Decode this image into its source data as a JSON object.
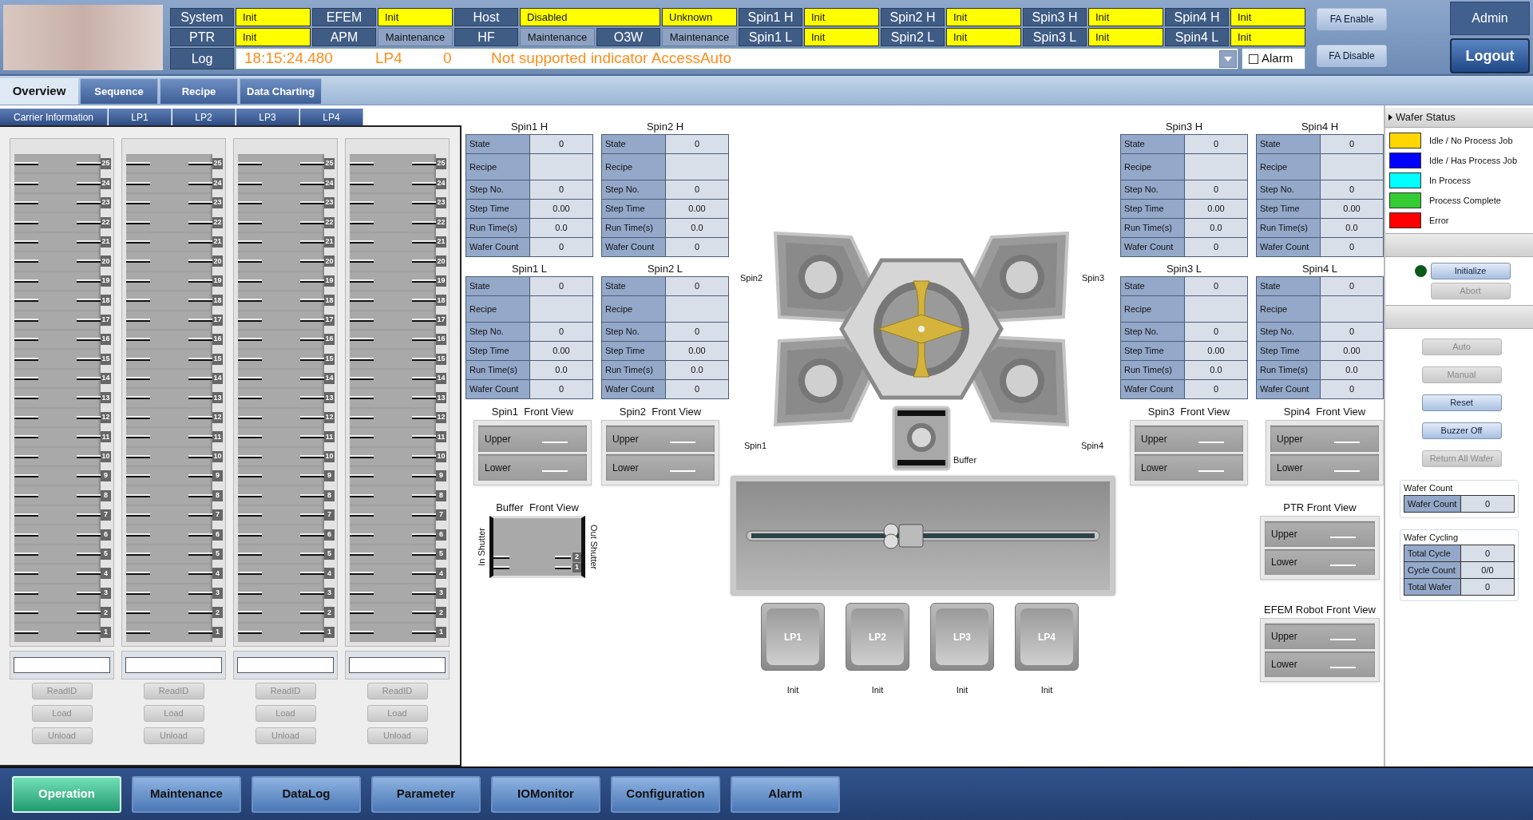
{
  "status_rows": [
    [
      {
        "kind": "label",
        "text": "System"
      },
      {
        "kind": "value",
        "text": "Init",
        "highlighted": true
      },
      {
        "kind": "label",
        "text": "EFEM"
      },
      {
        "kind": "value",
        "text": "Init",
        "highlighted": true
      },
      {
        "kind": "label",
        "text": "Host"
      },
      {
        "kind": "value",
        "text": "Disabled",
        "highlighted": true
      },
      {
        "kind": "value",
        "text": "Unknown",
        "highlighted": true
      },
      {
        "kind": "label",
        "text": "Spin1 H"
      },
      {
        "kind": "value",
        "text": "Init",
        "highlighted": true
      },
      {
        "kind": "label",
        "text": "Spin2 H"
      },
      {
        "kind": "value",
        "text": "Init",
        "highlighted": true
      },
      {
        "kind": "label",
        "text": "Spin3 H"
      },
      {
        "kind": "value",
        "text": "Init",
        "highlighted": true
      },
      {
        "kind": "label",
        "text": "Spin4 H"
      },
      {
        "kind": "value",
        "text": "Init",
        "highlighted": true
      }
    ],
    [
      {
        "kind": "label",
        "text": "PTR"
      },
      {
        "kind": "value",
        "text": "Init",
        "highlighted": true
      },
      {
        "kind": "label",
        "text": "APM"
      },
      {
        "kind": "value",
        "text": "Maintenance",
        "highlighted": false
      },
      {
        "kind": "label",
        "text": "HF"
      },
      {
        "kind": "value",
        "text": "Maintenance",
        "highlighted": false
      },
      {
        "kind": "label",
        "text": "O3W"
      },
      {
        "kind": "value",
        "text": "Maintenance",
        "highlighted": false
      },
      {
        "kind": "label",
        "text": "Spin1 L"
      },
      {
        "kind": "value",
        "text": "Init",
        "highlighted": true
      },
      {
        "kind": "label",
        "text": "Spin2 L"
      },
      {
        "kind": "value",
        "text": "Init",
        "highlighted": true
      },
      {
        "kind": "label",
        "text": "Spin3 L"
      },
      {
        "kind": "value",
        "text": "Init",
        "highlighted": true
      },
      {
        "kind": "label",
        "text": "Spin4 L"
      },
      {
        "kind": "value",
        "text": "Init",
        "highlighted": true
      }
    ]
  ],
  "log": {
    "label": "Log",
    "time": "18:15:24.480",
    "source": "LP4",
    "code": "0",
    "message": "Not supported indicator AccessAuto"
  },
  "alarm": {
    "label": "Alarm",
    "checked": false
  },
  "fa_buttons": [
    "FA Enable",
    "FA Disable"
  ],
  "user": "Admin",
  "logout": "Logout",
  "main_tabs": [
    {
      "label": "Overview",
      "selected": true
    },
    {
      "label": "Sequence",
      "selected": false
    },
    {
      "label": "Recipe",
      "selected": false
    },
    {
      "label": "Data Charting",
      "selected": false
    }
  ],
  "sub_tabs": [
    "Carrier Information",
    "LP1",
    "LP2",
    "LP3",
    "LP4"
  ],
  "carriers": [
    {
      "slots": [
        "25",
        "24",
        "23",
        "22",
        "21",
        "20",
        "19",
        "18",
        "17",
        "16",
        "15",
        "14",
        "13",
        "12",
        "11",
        "10",
        "9",
        "8",
        "7",
        "6",
        "5",
        "4",
        "3",
        "2",
        "1"
      ],
      "buttons": [
        {
          "label": "ReadID",
          "disabled": true
        },
        {
          "label": "Load",
          "disabled": true
        },
        {
          "label": "Unload",
          "disabled": true
        }
      ]
    },
    {
      "slots": [
        "25",
        "24",
        "23",
        "22",
        "21",
        "20",
        "19",
        "18",
        "17",
        "16",
        "15",
        "14",
        "13",
        "12",
        "11",
        "10",
        "9",
        "8",
        "7",
        "6",
        "5",
        "4",
        "3",
        "2",
        "1"
      ],
      "buttons": [
        {
          "label": "ReadID",
          "disabled": true
        },
        {
          "label": "Load",
          "disabled": true
        },
        {
          "label": "Unload",
          "disabled": true
        }
      ]
    },
    {
      "slots": [
        "25",
        "24",
        "23",
        "22",
        "21",
        "20",
        "19",
        "18",
        "17",
        "16",
        "15",
        "14",
        "13",
        "12",
        "11",
        "10",
        "9",
        "8",
        "7",
        "6",
        "5",
        "4",
        "3",
        "2",
        "1"
      ],
      "buttons": [
        {
          "label": "ReadID",
          "disabled": true
        },
        {
          "label": "Load",
          "disabled": true
        },
        {
          "label": "Unload",
          "disabled": true
        }
      ]
    },
    {
      "slots": [
        "25",
        "24",
        "23",
        "22",
        "21",
        "20",
        "19",
        "18",
        "17",
        "16",
        "15",
        "14",
        "13",
        "12",
        "11",
        "10",
        "9",
        "8",
        "7",
        "6",
        "5",
        "4",
        "3",
        "2",
        "1"
      ],
      "buttons": [
        {
          "label": "ReadID",
          "disabled": true
        },
        {
          "label": "Load",
          "disabled": true
        },
        {
          "label": "Unload",
          "disabled": true
        }
      ]
    }
  ],
  "left_tables": [
    {
      "title": "Spin1 H",
      "rows": [
        {
          "label": "State",
          "value": "0"
        },
        {
          "label": "Recipe"
        },
        {
          "label": "Step No.",
          "value": "0"
        },
        {
          "label": "Step Time",
          "value": "0.00"
        },
        {
          "label": "Run Time(s)",
          "value": "0.0"
        },
        {
          "label": "Wafer Count",
          "value": "0"
        }
      ]
    },
    {
      "title": "Spin2 H",
      "rows": [
        {
          "label": "State",
          "value": "0"
        },
        {
          "label": "Recipe"
        },
        {
          "label": "Step No.",
          "value": "0"
        },
        {
          "label": "Step Time",
          "value": "0.00"
        },
        {
          "label": "Run Time(s)",
          "value": "0.0"
        },
        {
          "label": "Wafer Count",
          "value": "0"
        }
      ]
    },
    {
      "title": "Spin1 L",
      "rows": [
        {
          "label": "State",
          "value": "0"
        },
        {
          "label": "Recipe"
        },
        {
          "label": "Step No.",
          "value": "0"
        },
        {
          "label": "Step Time",
          "value": "0.00"
        },
        {
          "label": "Run Time(s)",
          "value": "0.0"
        },
        {
          "label": "Wafer Count",
          "value": "0"
        }
      ]
    },
    {
      "title": "Spin2 L",
      "rows": [
        {
          "label": "State",
          "value": "0"
        },
        {
          "label": "Recipe"
        },
        {
          "label": "Step No.",
          "value": "0"
        },
        {
          "label": "Step Time",
          "value": "0.00"
        },
        {
          "label": "Run Time(s)",
          "value": "0.0"
        },
        {
          "label": "Wafer Count",
          "value": "0"
        }
      ]
    }
  ],
  "left_front_views": [
    {
      "title": "Spin1  Front View",
      "slots": [
        "Upper",
        "Lower"
      ]
    },
    {
      "title": "Spin2  Front View",
      "slots": [
        "Upper",
        "Lower"
      ]
    }
  ],
  "buffer_view": {
    "title": "Buffer  Front View",
    "left_label": "In Shutter",
    "right_label": "Out Shutter",
    "slots": [
      "2",
      "1"
    ]
  },
  "tool": {
    "chamber_labels": [
      "Spin2",
      "Spin3",
      "Spin1",
      "Spin4"
    ],
    "buffer_label": "Buffer",
    "load_ports": [
      {
        "label": "LP1",
        "status": "Init"
      },
      {
        "label": "LP2",
        "status": "Init"
      },
      {
        "label": "LP3",
        "status": "Init"
      },
      {
        "label": "LP4",
        "status": "Init"
      }
    ]
  },
  "right_tables": [
    {
      "title": "Spin3 H",
      "rows": [
        {
          "label": "State",
          "value": "0"
        },
        {
          "label": "Recipe"
        },
        {
          "label": "Step No.",
          "value": "0"
        },
        {
          "label": "Step Time",
          "value": "0.00"
        },
        {
          "label": "Run Time(s)",
          "value": "0.0"
        },
        {
          "label": "Wafer Count",
          "value": "0"
        }
      ]
    },
    {
      "title": "Spin4 H",
      "rows": [
        {
          "label": "State",
          "value": "0"
        },
        {
          "label": "Recipe"
        },
        {
          "label": "Step No.",
          "value": "0"
        },
        {
          "label": "Step Time",
          "value": "0.00"
        },
        {
          "label": "Run Time(s)",
          "value": "0.0"
        },
        {
          "label": "Wafer Count",
          "value": "0"
        }
      ]
    },
    {
      "title": "Spin3 L",
      "rows": [
        {
          "label": "State",
          "value": "0"
        },
        {
          "label": "Recipe"
        },
        {
          "label": "Step No.",
          "value": "0"
        },
        {
          "label": "Step Time",
          "value": "0.00"
        },
        {
          "label": "Run Time(s)",
          "value": "0.0"
        },
        {
          "label": "Wafer Count",
          "value": "0"
        }
      ]
    },
    {
      "title": "Spin4 L",
      "rows": [
        {
          "label": "State",
          "value": "0"
        },
        {
          "label": "Recipe"
        },
        {
          "label": "Step No.",
          "value": "0"
        },
        {
          "label": "Step Time",
          "value": "0.00"
        },
        {
          "label": "Run Time(s)",
          "value": "0.0"
        },
        {
          "label": "Wafer Count",
          "value": "0"
        }
      ]
    }
  ],
  "right_front_views": [
    {
      "title": "Spin3  Front View",
      "slots": [
        "Upper",
        "Lower"
      ]
    },
    {
      "title": "Spin4  Front View",
      "slots": [
        "Upper",
        "Lower"
      ]
    }
  ],
  "ptr_view": {
    "title": "PTR Front View",
    "slots": [
      "Upper",
      "Lower"
    ]
  },
  "efem_view": {
    "title": "EFEM Robot Front View",
    "slots": [
      "Upper",
      "Lower"
    ]
  },
  "wafer_status": {
    "title": "Wafer Status",
    "legend": [
      {
        "label": "Idle / No Process Job",
        "color": "#ffd700"
      },
      {
        "label": "Idle / Has Process Job",
        "color": "#0000ff"
      },
      {
        "label": "In Process",
        "color": "#00ffff"
      },
      {
        "label": "Process Complete",
        "color": "#33cc33"
      },
      {
        "label": "Error",
        "color": "#ff0000"
      }
    ]
  },
  "init_controls": {
    "indicator_on": true,
    "buttons": [
      {
        "label": "Initialize",
        "disabled": false
      },
      {
        "label": "Abort",
        "disabled": true
      }
    ]
  },
  "mode_buttons": [
    {
      "label": "Auto",
      "disabled": true
    },
    {
      "label": "Manual",
      "disabled": true
    },
    {
      "label": "Reset",
      "disabled": false
    },
    {
      "label": "Buzzer Off",
      "disabled": false
    },
    {
      "label": "Return All Wafer",
      "disabled": true
    }
  ],
  "wafer_count": {
    "title": "Wafer Count",
    "rows": [
      {
        "label": "Wafer Count",
        "value": "0"
      }
    ]
  },
  "wafer_cycling": {
    "title": "Wafer Cycling",
    "rows": [
      {
        "label": "Total Cycle",
        "value": "0"
      },
      {
        "label": "Cycle Count",
        "value": "0/0"
      },
      {
        "label": "Total Wafer",
        "value": "0"
      }
    ]
  },
  "nav": [
    {
      "label": "Operation",
      "selected": true
    },
    {
      "label": "Maintenance",
      "selected": false
    },
    {
      "label": "DataLog",
      "selected": false
    },
    {
      "label": "Parameter",
      "selected": false
    },
    {
      "label": "IOMonitor",
      "selected": false
    },
    {
      "label": "Configuration",
      "selected": false
    },
    {
      "label": "Alarm",
      "selected": false
    }
  ]
}
